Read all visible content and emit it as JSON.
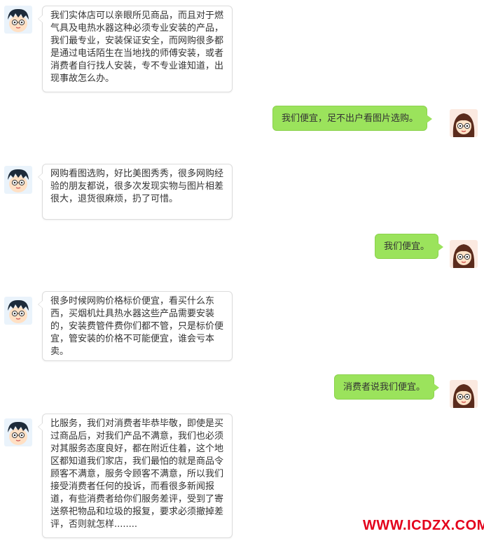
{
  "messages": [
    {
      "side": "left",
      "text": "我们实体店可以亲眼所见商品，而且对于燃气具及电热水器这种必须专业安装的产品，我们最专业，安装保证安全，而网购很多都是通过电话陌生在当地找的师傅安装，或者消费者自行找人安装，专不专业谁知道，出现事故怎么办。"
    },
    {
      "side": "right",
      "text": "我们便宜，足不出户看图片选购。"
    },
    {
      "side": "left",
      "text": "网购看图选购，好比美图秀秀，很多网购经验的朋友都说，很多次发现实物与图片相差很大，退货很麻烦，扔了可惜。"
    },
    {
      "side": "right",
      "text": "我们便宜。"
    },
    {
      "side": "left",
      "text": "很多时候网购价格标价便宜，看买什么东西，买烟机灶具热水器这些产品需要安装的，安装费管件费你们都不管，只是标价便宜，管安装的价格不可能便宜，谁会亏本卖。"
    },
    {
      "side": "right",
      "text": "消费者说我们便宜。"
    },
    {
      "side": "left",
      "text": "比服务，我们对消费者毕恭毕敬，即使是买过商品后，对我们产品不满意，我们也必须对其服务态度良好，都在附近住着，这个地区都知道我们家店，我们最怕的就是商品令顾客不满意，服务令顾客不满意，所以我们接受消费者任何的投诉，而看很多新闻报道，有些消费者给你们服务差评，受到了寄送祭祀物品和垃圾的报复，要求必须撤掉差评，否则就怎样........"
    }
  ],
  "watermark": "WWW.ICDZX.COM",
  "colors": {
    "right_bubble": "#9be35c",
    "watermark": "#e3001b"
  },
  "icons": {
    "left_avatar": "boy-cartoon-avatar-icon",
    "right_avatar": "girl-cartoon-avatar-icon"
  }
}
